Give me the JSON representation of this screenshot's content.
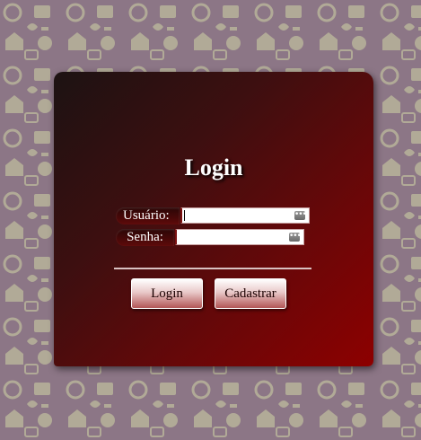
{
  "login": {
    "title": "Login",
    "username_label": "Usuário:",
    "password_label": "Senha:",
    "username_value": "",
    "password_value": "",
    "login_button": "Login",
    "register_button": "Cadastrar"
  },
  "colors": {
    "background": "#8c7686",
    "panel_start": "#1c1212",
    "panel_end": "#8d0000",
    "text": "#ffffff"
  },
  "icons": {
    "background_pattern": "social-media-icons-pattern",
    "field_icon": "password-manager-key-icon"
  }
}
